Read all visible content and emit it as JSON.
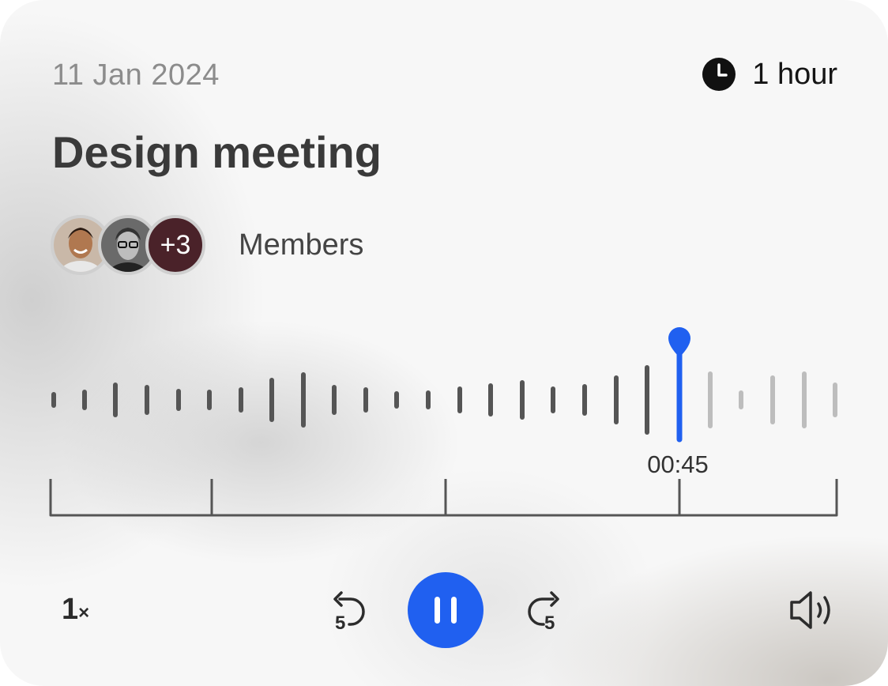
{
  "meeting": {
    "date": "11 Jan 2024",
    "duration": "1 hour",
    "title": "Design meeting"
  },
  "members": {
    "extra_count": "+3",
    "label": "Members"
  },
  "player": {
    "current_time": "00:45",
    "playback_speed": "1×",
    "speed_number": "1",
    "speed_suffix": "×",
    "skip_back_seconds": "5",
    "skip_forward_seconds": "5",
    "state": "playing",
    "progress": 0.8
  },
  "colors": {
    "accent": "#2060f0",
    "played_bar": "#555555",
    "unplayed_bar": "#bdbdbd"
  },
  "icons": {
    "duration": "clock-icon",
    "skip_back": "rewind-5-icon",
    "play_pause": "pause-icon",
    "skip_forward": "forward-5-icon",
    "volume": "speaker-icon"
  }
}
